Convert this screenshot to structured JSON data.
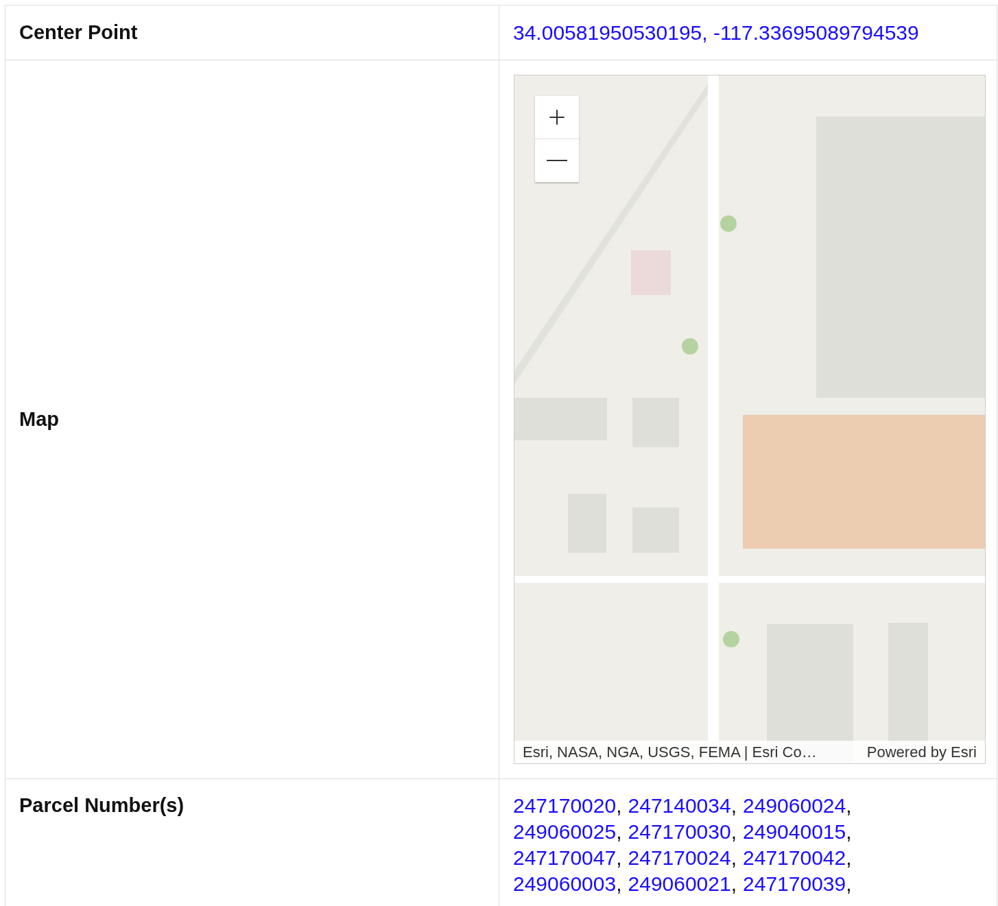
{
  "rows": [
    {
      "kind": "text",
      "label": "Center Point",
      "value": "34.00581950530195, -117.33695089794539"
    },
    {
      "kind": "map",
      "label": "Map",
      "map": {
        "kind": "picture",
        "attribution": "Esri, NASA, NGA, USGS, FEMA | Esri Co…",
        "powered_by": "Powered by Esri"
      }
    },
    {
      "kind": "links",
      "label": "Parcel Number(s)",
      "separator": ",",
      "links": [
        "247170020",
        "247140034",
        "249060024",
        "249060025",
        "247170030",
        "249040015",
        "247170047",
        "247170024",
        "247170042",
        "249060003",
        "249060021",
        "247170039"
      ]
    }
  ]
}
